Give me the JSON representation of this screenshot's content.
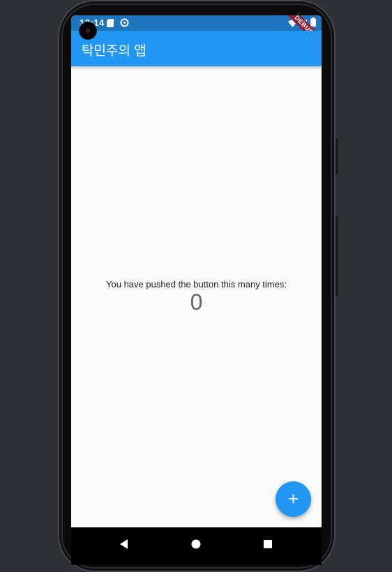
{
  "status_bar": {
    "time": "12:14"
  },
  "debug_banner": {
    "label": "DEBUG"
  },
  "app_bar": {
    "title": "탁민주의 앱"
  },
  "main": {
    "message": "You have pushed the button this many times:",
    "counter": "0"
  },
  "fab": {
    "label": "+"
  },
  "icons": {
    "status": [
      "sd-card-icon",
      "data-saver-icon",
      "wifi-icon",
      "signal-icon",
      "battery-icon"
    ],
    "nav": [
      "back-icon",
      "home-icon",
      "recents-icon"
    ]
  },
  "colors": {
    "primary": "#2196f3",
    "status_bar": "#1f75bd",
    "background": "#fafafa",
    "debug_banner": "#8c2038"
  }
}
